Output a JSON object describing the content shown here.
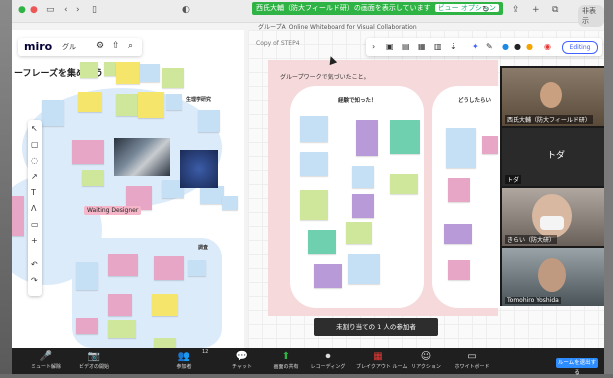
{
  "browser": {
    "share_banner": "西氏大輔（防大フィールド研）の画面を表示しています",
    "view_options": "ビュー オプション",
    "hide_button": "非表示",
    "url": "グループA_Online Whiteboard for Visual Collaboration"
  },
  "miro": {
    "logo": "miro",
    "board_name": "グル",
    "step_label": "Copy of STEP4",
    "editing": "Editing",
    "left_title": "ーフレーズを集めよう",
    "section_label": "生理学研究",
    "section_label2": "調査",
    "image_tag": "Waiting Designer"
  },
  "board": {
    "pink_title": "グループワークで気づいたこと。",
    "col1_title": "経験で知った！",
    "col2_title": "どうしたらい"
  },
  "left_notes": [
    {
      "text": "",
      "color": "#cfe79a"
    },
    {
      "text": "",
      "color": "#cfe79a"
    },
    {
      "text": "",
      "color": "#f5e66b"
    },
    {
      "text": "",
      "color": "#c5e0f5"
    },
    {
      "text": "",
      "color": "#cfe79a"
    },
    {
      "text": "",
      "color": "#c5e0f5"
    },
    {
      "text": "",
      "color": "#f5e66b"
    },
    {
      "text": "",
      "color": "#cfe79a"
    },
    {
      "text": "",
      "color": "#f5e66b"
    },
    {
      "text": "",
      "color": "#c5e0f5"
    },
    {
      "text": "",
      "color": "#c5e0f5"
    },
    {
      "text": "",
      "color": "#e8a6c6"
    },
    {
      "text": "",
      "color": "#cfe79a"
    },
    {
      "text": "",
      "color": "#c5e0f5"
    },
    {
      "text": "",
      "color": "#e8a6c6"
    },
    {
      "text": "",
      "color": "#c5e0f5"
    },
    {
      "text": "",
      "color": "#c5e0f5"
    },
    {
      "text": "",
      "color": "#e8a6c6"
    },
    {
      "text": "",
      "color": "#e8a6c6"
    },
    {
      "text": "",
      "color": "#e8a6c6"
    },
    {
      "text": "",
      "color": "#c5e0f5"
    },
    {
      "text": "",
      "color": "#e8a6c6"
    },
    {
      "text": "",
      "color": "#f5e66b"
    },
    {
      "text": "",
      "color": "#e8a6c6"
    },
    {
      "text": "",
      "color": "#cfe79a"
    },
    {
      "text": "",
      "color": "#c5e0f5"
    },
    {
      "text": "",
      "color": "#cfe79a"
    }
  ],
  "right_notes": [
    {
      "text": "",
      "color": "#c5e0f5"
    },
    {
      "text": "",
      "color": "#b89ad8"
    },
    {
      "text": "",
      "color": "#6fd0b0"
    },
    {
      "text": "",
      "color": "#c5e0f5"
    },
    {
      "text": "",
      "color": "#c5e0f5"
    },
    {
      "text": "",
      "color": "#cfe79a"
    },
    {
      "text": "",
      "color": "#b89ad8"
    },
    {
      "text": "",
      "color": "#cfe79a"
    },
    {
      "text": "",
      "color": "#6fd0b0"
    },
    {
      "text": "",
      "color": "#cfe79a"
    },
    {
      "text": "",
      "color": "#c5e0f5"
    },
    {
      "text": "",
      "color": "#b89ad8"
    },
    {
      "text": "",
      "color": "#c5e0f5"
    },
    {
      "text": "",
      "color": "#e8a6c6"
    },
    {
      "text": "",
      "color": "#e8a6c6"
    },
    {
      "text": "",
      "color": "#b89ad8"
    },
    {
      "text": "",
      "color": "#e8a6c6"
    }
  ],
  "video": {
    "p1_name": "西氏大輔（防大フィールド研）",
    "p2_center": "トダ",
    "p2_name": "トダ",
    "p3_name": "きらい（防大研）",
    "p4_name": "Tomohiro Yoshida"
  },
  "tooltip": "未割り当ての 1 人の参加者",
  "zoom": {
    "items": [
      {
        "icon": "🎤",
        "label": "ミュート解除"
      },
      {
        "icon": "📷",
        "label": "ビデオの開始"
      },
      {
        "icon": "👥",
        "label": "参加者"
      },
      {
        "icon": "💬",
        "label": "チャット"
      },
      {
        "icon": "⬆",
        "label": "画面の共有"
      },
      {
        "icon": "⏺",
        "label": "レコーディング"
      },
      {
        "icon": "▦",
        "label": "ブレイクアウト ルーム"
      },
      {
        "icon": "☺",
        "label": "リアクション"
      },
      {
        "icon": "▭",
        "label": "ホワイトボード"
      }
    ],
    "participants_count": "12",
    "end_button": "ルームを退出する"
  }
}
